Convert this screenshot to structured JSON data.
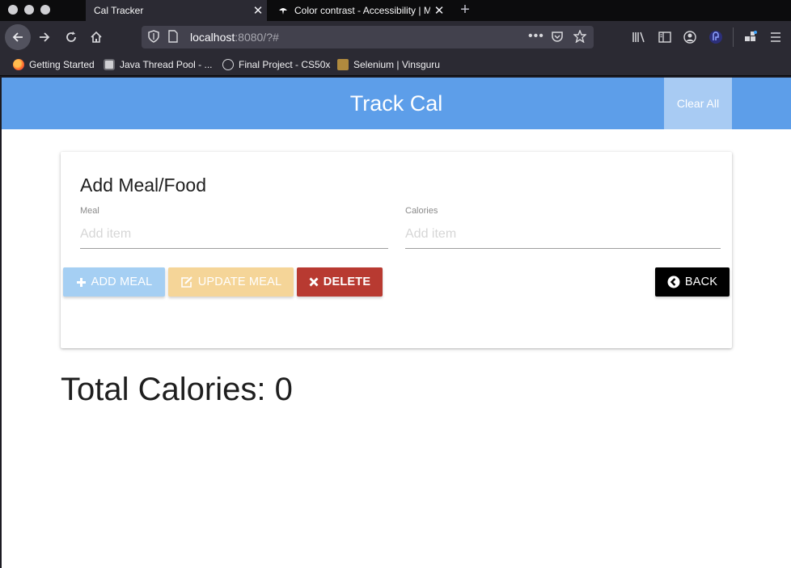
{
  "browser": {
    "tabs": [
      {
        "title": "Cal Tracker",
        "active": true
      },
      {
        "title": "Color contrast - Accessibility | M",
        "active": false
      }
    ],
    "url_host": "localhost",
    "url_rest": ":8080/?#",
    "bookmarks": [
      {
        "label": "Getting Started"
      },
      {
        "label": "Java Thread Pool - ..."
      },
      {
        "label": "Final Project - CS50x"
      },
      {
        "label": "Selenium | Vinsguru"
      }
    ]
  },
  "app": {
    "brand": "Track Cal",
    "clear_all": "Clear All",
    "form": {
      "title": "Add Meal/Food",
      "meal_label": "Meal",
      "meal_placeholder": "Add item",
      "meal_value": "",
      "calories_label": "Calories",
      "calories_placeholder": "Add item",
      "calories_value": ""
    },
    "buttons": {
      "add": "ADD MEAL",
      "update": "UPDATE MEAL",
      "delete": "DELETE",
      "back": "BACK"
    },
    "total_label": "Total Calories: ",
    "total_value": "0"
  },
  "colors": {
    "header": "#5d9ee9",
    "add": "#a5cff3",
    "update": "#f5d598",
    "delete": "#b83a31",
    "back": "#000000"
  }
}
